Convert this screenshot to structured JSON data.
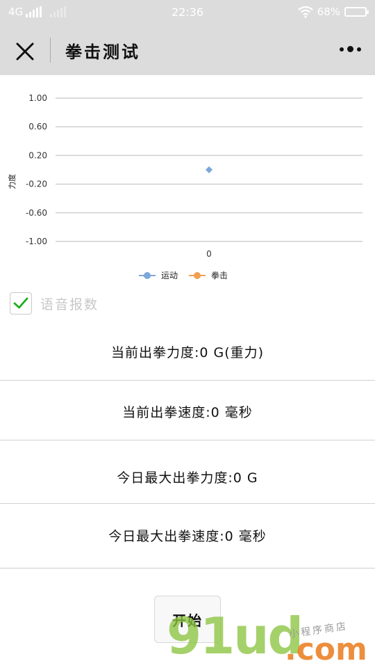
{
  "status_bar": {
    "network": "4G",
    "time": "22:36",
    "battery": "68%"
  },
  "header": {
    "title": "拳击测试",
    "close_icon": "close-icon",
    "more_icon": "more-dots-icon"
  },
  "chart_data": {
    "type": "scatter",
    "ylabel": "力度",
    "xlabel": "",
    "y_ticks": [
      "1.00",
      "0.60",
      "0.20",
      "-0.20",
      "-0.60",
      "-1.00"
    ],
    "x_ticks": [
      "0"
    ],
    "ylim": [
      -1,
      1
    ],
    "series": [
      {
        "name": "运动",
        "color": "#7aa8d8",
        "points": [
          {
            "x": 0,
            "y": 0
          }
        ]
      },
      {
        "name": "拳击",
        "color": "#f0a050",
        "points": []
      }
    ],
    "grid": true,
    "legend_position": "bottom"
  },
  "voice_option": {
    "label": "语音报数",
    "checked": true
  },
  "stats": {
    "current_power": "当前出拳力度:0 G(重力)",
    "current_speed": "当前出拳速度:0 毫秒",
    "today_max_power": "今日最大出拳力度:0 G",
    "today_max_speed": "今日最大出拳速度:0 毫秒"
  },
  "start_button": {
    "label": "开始"
  },
  "watermark": {
    "main": "91ud",
    "dot": ".com",
    "sub": "小程序商店"
  }
}
